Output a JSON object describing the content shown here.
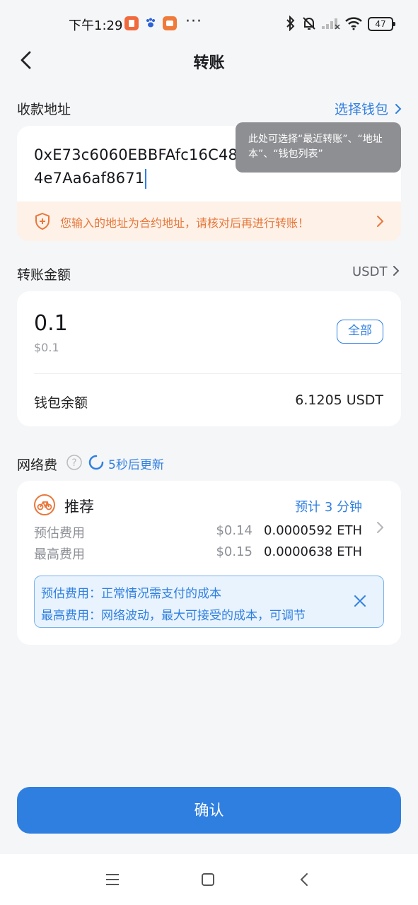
{
  "status_bar": {
    "time": "下午1:29",
    "more_dots": "···",
    "battery": "47",
    "icons": [
      "app-notification-icon",
      "paw-icon",
      "app-notification-icon",
      "bluetooth-icon",
      "mute-bell-icon",
      "signal-icon",
      "wifi-icon",
      "battery-icon"
    ]
  },
  "header": {
    "title": "转账",
    "back_icon": "chevron-left-icon"
  },
  "recipient": {
    "label": "收款地址",
    "select_wallet": "选择钱包",
    "address_line1": "0xE73c6060EBBFAfc16C48",
    "address_line2": "4e7Aa6af8671",
    "tooltip": "此处可选择“最近转账”、“地址本”、“钱包列表”",
    "warning": "您输入的地址为合约地址，请核对后再进行转账！"
  },
  "amount": {
    "label": "转账金额",
    "token": "USDT",
    "value": "0.1",
    "usd_value": "$0.1",
    "all_button": "全部",
    "balance_label": "钱包余额",
    "balance_value": "6.1205 USDT"
  },
  "network_fee": {
    "label": "网络费",
    "refresh_text": "5秒后更新",
    "tier_name": "推荐",
    "eta": "预计 3 分钟",
    "estimated_label": "预估费用",
    "estimated_usd": "$0.14",
    "estimated_eth": "0.0000592 ETH",
    "max_label": "最高费用",
    "max_usd": "$0.15",
    "max_eth": "0.0000638 ETH",
    "info_line1": "预估费用：正常情况需支付的成本",
    "info_line2": "最高费用：网络波动，最大可接受的成本，可调节"
  },
  "confirm_button": "确认",
  "colors": {
    "accent": "#2f7fe0",
    "warning": "#e8773a",
    "background": "#f5f6f8"
  }
}
